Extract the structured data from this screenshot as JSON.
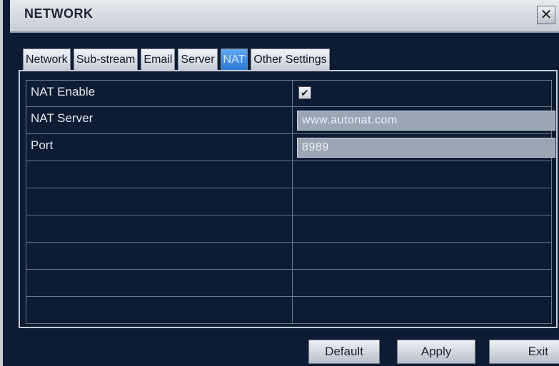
{
  "window": {
    "title": "NETWORK",
    "close_label": "✕"
  },
  "tabs": [
    {
      "label": "Network",
      "active": false
    },
    {
      "label": "Sub-stream",
      "active": false
    },
    {
      "label": "Email",
      "active": false
    },
    {
      "label": "Server",
      "active": false
    },
    {
      "label": "NAT",
      "active": true
    },
    {
      "label": "Other Settings",
      "active": false
    }
  ],
  "settings": {
    "nat_enable_label": "NAT Enable",
    "nat_enable_checked": true,
    "nat_enable_mark": "✔",
    "nat_server_label": "NAT Server",
    "nat_server_value": "www.autonat.com",
    "port_label": "Port",
    "port_value": "8989"
  },
  "buttons": {
    "default": "Default",
    "apply": "Apply",
    "exit": "Exit"
  },
  "colors": {
    "active_tab": "#3b8be3",
    "background": "#0d1c33"
  }
}
